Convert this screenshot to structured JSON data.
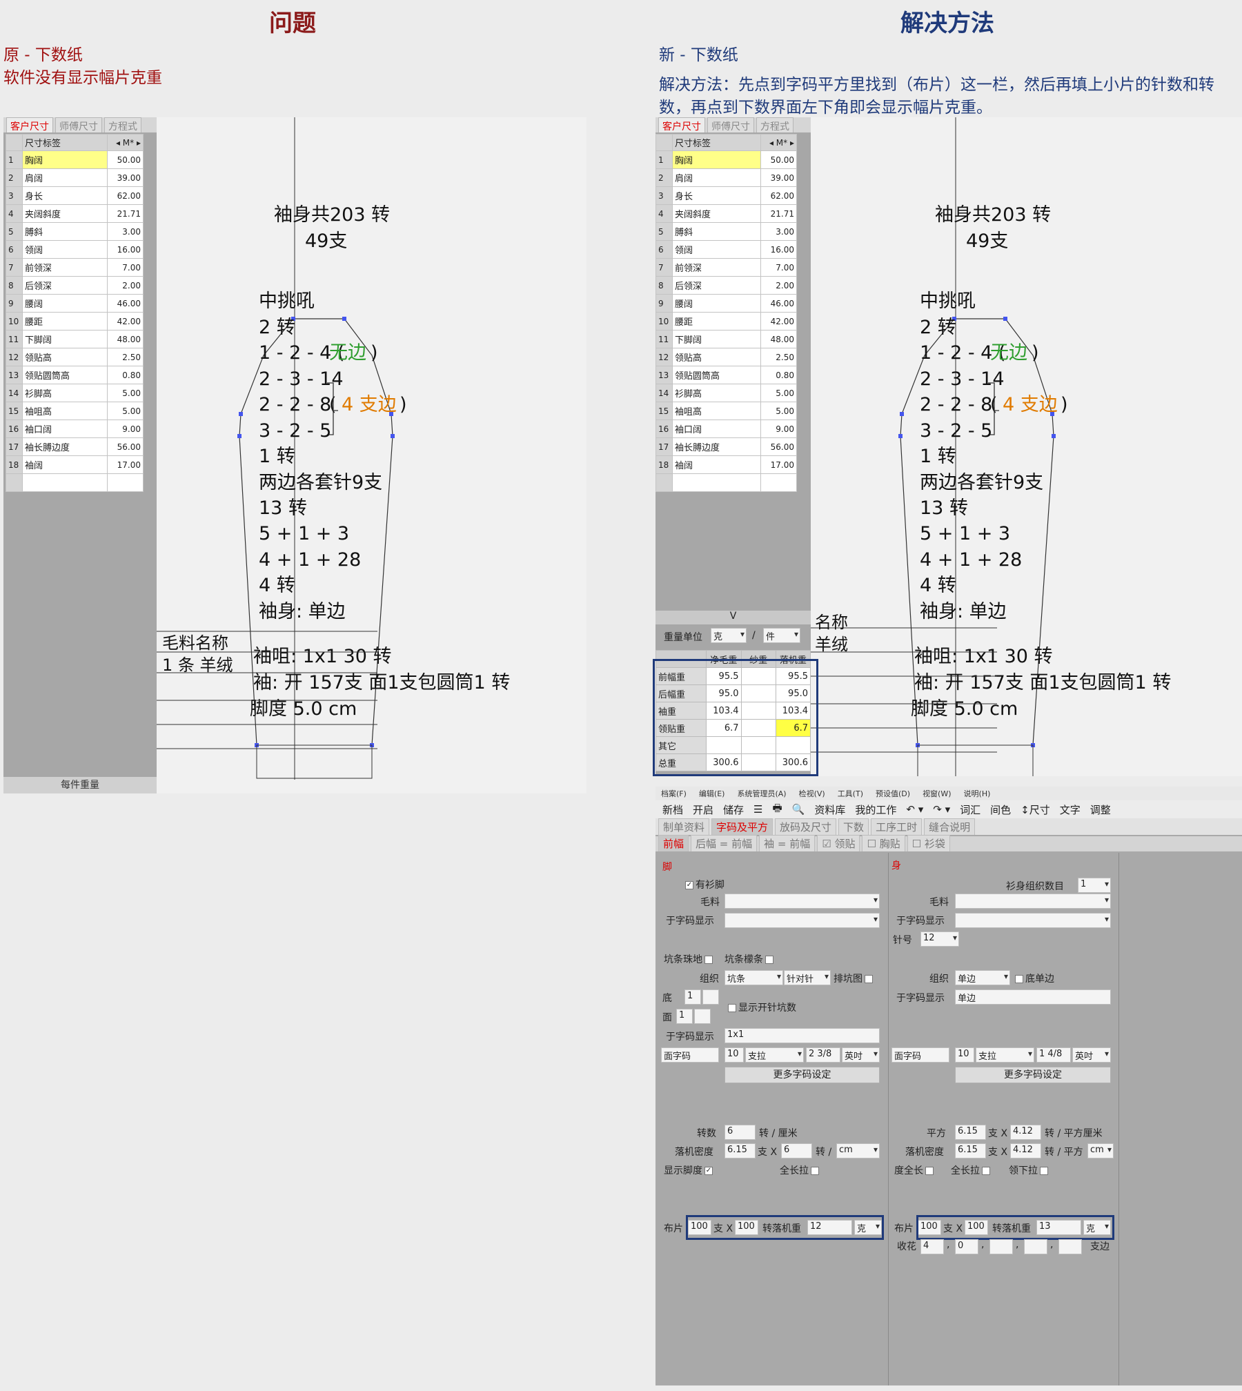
{
  "header": {
    "left_title": "问题",
    "right_title": "解决方法",
    "title_color_left": "#8b1a1a",
    "title_color_right": "#1f3a7a"
  },
  "left": {
    "caption1": "原 - 下数纸",
    "caption2": "软件没有显示幅片克重",
    "footer_label": "每件重量"
  },
  "right": {
    "caption1": "新 - 下数纸",
    "caption2": "解决方法：先点到字码平方里找到（布片）这一栏，然后再填上小片的针数和转数，再点到下数界面左下角即会显示幅片克重。"
  },
  "size_tabs": [
    "客户尺寸",
    "师傅尺寸",
    "方程式"
  ],
  "size_header": {
    "label": "尺寸标签",
    "unit": "◂ M* ▸"
  },
  "left_sizes": [
    {
      "n": "1",
      "label": "胸阔",
      "value": "50.00"
    },
    {
      "n": "2",
      "label": "肩阔",
      "value": "39.00"
    },
    {
      "n": "3",
      "label": "身长",
      "value": "62.00"
    },
    {
      "n": "4",
      "label": "夹阔斜度",
      "value": "21.71"
    },
    {
      "n": "5",
      "label": "膊斜",
      "value": "3.00"
    },
    {
      "n": "6",
      "label": "领阔",
      "value": "16.00"
    },
    {
      "n": "7",
      "label": "前领深",
      "value": "7.00"
    },
    {
      "n": "8",
      "label": "后领深",
      "value": "2.00"
    },
    {
      "n": "9",
      "label": "腰阔",
      "value": "46.00"
    },
    {
      "n": "10",
      "label": "腰距",
      "value": "42.00"
    },
    {
      "n": "11",
      "label": "下脚阔",
      "value": "48.00"
    },
    {
      "n": "12",
      "label": "领贴高",
      "value": "2.50"
    },
    {
      "n": "13",
      "label": "领贴圆筒高",
      "value": "0.80"
    },
    {
      "n": "14",
      "label": "衫脚高",
      "value": "5.00"
    },
    {
      "n": "15",
      "label": "袖咀高",
      "value": "5.00"
    },
    {
      "n": "16",
      "label": "袖口阔",
      "value": "9.00"
    },
    {
      "n": "17",
      "label": "袖长膊边度",
      "value": "56.00"
    },
    {
      "n": "18",
      "label": "袖阔",
      "value": "17.00"
    }
  ],
  "right_sizes": [
    {
      "n": "1",
      "label": "胸阔",
      "value": "50.00"
    },
    {
      "n": "2",
      "label": "肩阔",
      "value": "39.00"
    },
    {
      "n": "3",
      "label": "身长",
      "value": "62.00"
    },
    {
      "n": "4",
      "label": "夹阔斜度",
      "value": "21.71"
    },
    {
      "n": "5",
      "label": "膊斜",
      "value": "3.00"
    },
    {
      "n": "6",
      "label": "领阔",
      "value": "16.00"
    },
    {
      "n": "7",
      "label": "前领深",
      "value": "7.00"
    },
    {
      "n": "8",
      "label": "后领深",
      "value": "2.00"
    },
    {
      "n": "9",
      "label": "腰阔",
      "value": "46.00"
    },
    {
      "n": "10",
      "label": "腰距",
      "value": "42.00"
    },
    {
      "n": "11",
      "label": "下脚阔",
      "value": "48.00"
    },
    {
      "n": "12",
      "label": "领贴高",
      "value": "2.50"
    },
    {
      "n": "13",
      "label": "领贴圆筒高",
      "value": "0.80"
    },
    {
      "n": "14",
      "label": "衫脚高",
      "value": "5.00"
    },
    {
      "n": "15",
      "label": "袖咀高",
      "value": "5.00"
    },
    {
      "n": "16",
      "label": "袖口阔",
      "value": "9.00"
    },
    {
      "n": "17",
      "label": "袖长膊边度",
      "value": "56.00"
    },
    {
      "n": "18",
      "label": "袖阔",
      "value": "17.00"
    }
  ],
  "sleeve": {
    "line1": "袖身共203 转",
    "line2": "49支",
    "line3": "中挑吼",
    "line4": "2 转",
    "line5a": "1 - 2 - 4 (",
    "line5b": "无边",
    "line5c": ")",
    "line6": "2 - 3 - 14",
    "line7": "2 - 2 - 8",
    "line7b": "(",
    "line7c": "4 支边",
    "line7d": ")",
    "line8": "3 - 2 - 5",
    "line9": "1 转",
    "line10": "两边各套针9支",
    "line11": "13 转",
    "line12": "5 + 1 + 3",
    "line13": "4 + 1 + 28",
    "line14": "4 转",
    "line15": "袖身: 单边",
    "cuff1": "袖咀: 1x1   30 转",
    "cuff2": "袖: 开  157支  面1支包圆筒1 转",
    "cuff3": "脚度 5.0 cm"
  },
  "yarn": {
    "name_label": "毛料名称",
    "value": "1 条 羊绒",
    "name_label_r": "名称",
    "value_r": "羊绒"
  },
  "weight": {
    "header": "V",
    "unit_label": "重量单位",
    "unit": "克",
    "per_sep": "/",
    "per": "件",
    "cols": [
      "净毛重",
      "纱重",
      "落机重"
    ],
    "rows": [
      {
        "label": "前幅重",
        "a": "95.5",
        "b": "",
        "c": "95.5"
      },
      {
        "label": "后幅重",
        "a": "95.0",
        "b": "",
        "c": "95.0"
      },
      {
        "label": "袖重",
        "a": "103.4",
        "b": "",
        "c": "103.4"
      },
      {
        "label": "领贴重",
        "a": "6.7",
        "b": "",
        "c": "6.7"
      },
      {
        "label": "其它",
        "a": "",
        "b": "",
        "c": ""
      },
      {
        "label": "总重",
        "a": "300.6",
        "b": "",
        "c": "300.6"
      }
    ]
  },
  "app": {
    "menu": [
      "档案(F)",
      "编辑(E)",
      "系统管理员(A)",
      "检视(V)",
      "工具(T)",
      "预设值(D)",
      "视窗(W)",
      "说明(H)"
    ],
    "toolbar": [
      "新档",
      "开启",
      "储存",
      "☰",
      "🖶",
      "🔍",
      "资料库",
      "我的工作",
      "↶ ▾",
      "↷ ▾",
      "词汇",
      "间色",
      "↕尺寸",
      "文字",
      "调整"
    ],
    "tabs": [
      "制单资料",
      "字码及平方",
      "放码及尺寸",
      "下数",
      "工序工时",
      "缝合说明"
    ],
    "subtabs": [
      "前幅",
      "后幅 = 前幅",
      "袖 = 前幅",
      "☑ 领贴",
      "☐ 胸贴",
      "☐ 衫袋"
    ],
    "left_panel": {
      "title": "脚",
      "has_foot": "有衫脚",
      "yarn": "毛料",
      "code_show": "于字码显示",
      "rib_bead": "坑条珠地",
      "rib_strip": "坑条檬条",
      "org": "组织",
      "org_val": "坑条",
      "needle": "针对针",
      "rib_chart": "排坑图",
      "bottom": "底",
      "bottom_val": "1",
      "face": "面",
      "face_val": "1",
      "show_open": "显示开针坑数",
      "code_show2": "于字码显示",
      "code_val": "1x1",
      "face_code": "面字码",
      "fc1": "10",
      "fc2": "支拉",
      "fc3": "2 3/8",
      "fc4": "英吋",
      "more": "更多字码设定",
      "turns": "转数",
      "turns_val": "6",
      "turns_unit": "转 / 厘米",
      "drop": "落机密度",
      "drop1": "6.15",
      "dx": "支 X",
      "drop2": "6",
      "dunit": "转 /",
      "dcm": "cm",
      "showfoot": "显示脚度",
      "fulllen": "全长拉",
      "cloth": "布片",
      "c1": "100",
      "cx": "支 X",
      "c2": "100",
      "cturn": "转落机重",
      "c3": "12",
      "cunit": "克"
    },
    "right_panel": {
      "title": "身",
      "org_count": "衫身组织数目",
      "org_count_val": "1",
      "yarn": "毛料",
      "code_show": "于字码显示",
      "needle_no": "针号",
      "needle_val": "12",
      "org": "组织",
      "org_val": "单边",
      "bottom_edge": "底单边",
      "code_show2": "于字码显示",
      "code_val": "单边",
      "face_code": "面字码",
      "fc1": "10",
      "fc2": "支拉",
      "fc3": "1 4/8",
      "fc4": "英吋",
      "more": "更多字码设定",
      "sq": "平方",
      "sq1": "6.15",
      "sx": "支 X",
      "sq2": "4.12",
      "sunit": "转 / 平方厘米",
      "drop": "落机密度",
      "drop1": "6.15",
      "dx": "支 X",
      "drop2": "4.12",
      "dunit": "转 / 平方",
      "dcm": "cm",
      "full": "度全长",
      "fulllen": "全长拉",
      "neckdown": "领下拉",
      "cloth": "布片",
      "c1": "100",
      "cx": "支 X",
      "c2": "100",
      "cturn": "转落机重",
      "c3": "13",
      "cunit": "克",
      "shou": "收花",
      "s1": "4",
      "s2": "0",
      "comma": ",",
      "side": "支边"
    }
  }
}
